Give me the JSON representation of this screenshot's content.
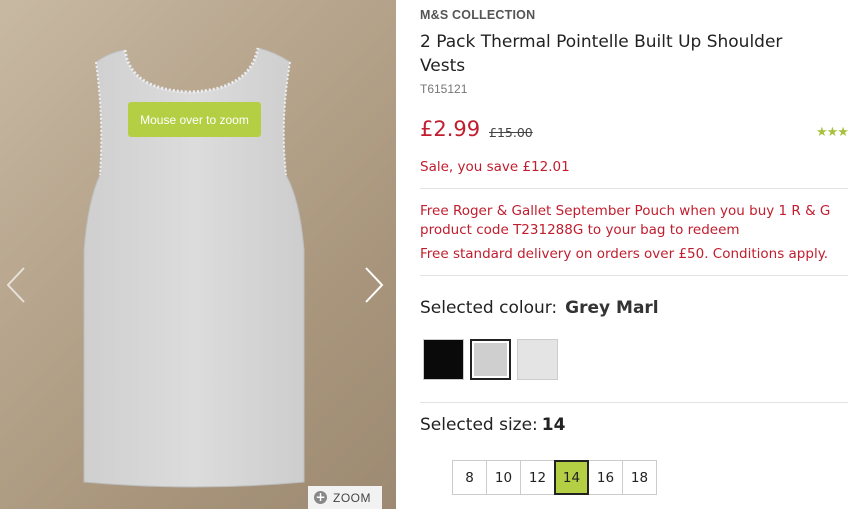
{
  "gallery": {
    "zoom_tip": "Mouse over to zoom",
    "zoom_button": "ZOOM",
    "zoom_icon": "+",
    "prev_icon": "chevron-left-icon",
    "next_icon": "chevron-right-icon"
  },
  "product": {
    "brand": "M&S COLLECTION",
    "title": "2 Pack Thermal Pointelle Built Up Shoulder Vests",
    "code": "T615121",
    "price": "£2.99",
    "was_price": "£15.00",
    "rating_stars": "★★★",
    "sale_text": "Sale, you save £12.01",
    "promo_line1": "Free Roger & Gallet September Pouch when you buy 1 R & G",
    "promo_line2": "product code T231288G to your bag to redeem",
    "delivery_text": "Free standard delivery on orders over £50. Conditions apply."
  },
  "colour": {
    "label": "Selected colour:",
    "value": "Grey Marl",
    "swatches": [
      {
        "name": "Black",
        "color": "#0a0a0a"
      },
      {
        "name": "Grey Marl",
        "color": "#cfcfcf"
      },
      {
        "name": "White",
        "color": "#e4e4e4"
      }
    ],
    "selected_index": 1
  },
  "size": {
    "label": "Selected size:",
    "value": "14",
    "options": [
      "8",
      "10",
      "12",
      "14",
      "16",
      "18"
    ],
    "selected_index": 3
  },
  "colors": {
    "accent_green": "#b5cf45",
    "sale_red": "#c01d2e"
  }
}
